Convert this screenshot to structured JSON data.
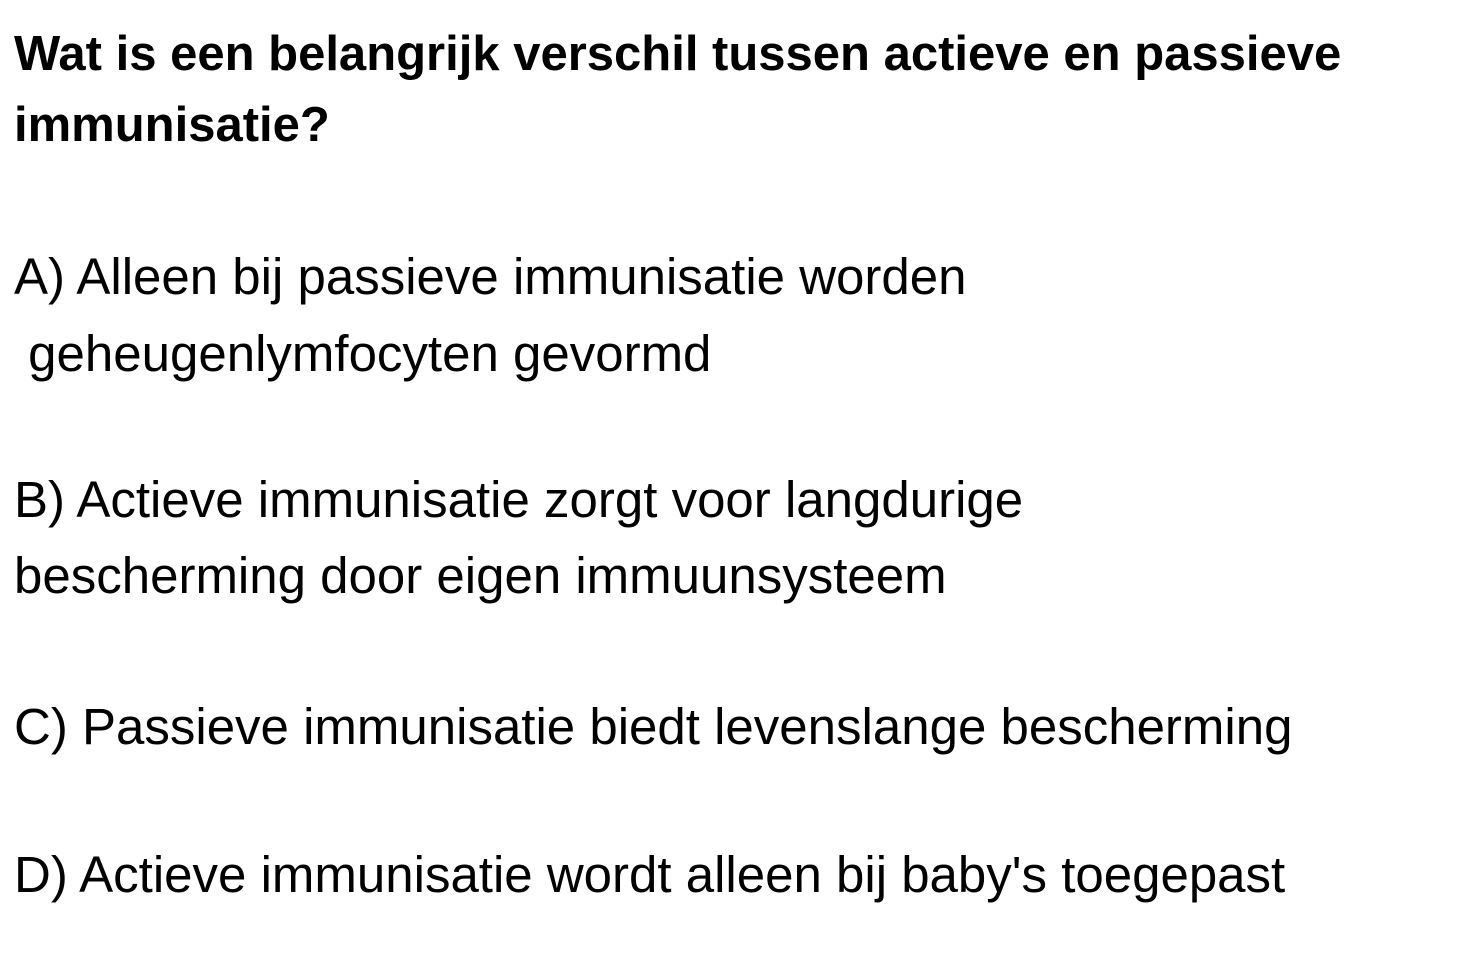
{
  "question": {
    "line1": "Wat is een belangrijk verschil tussen actieve en passieve",
    "line2": "immunisatie?"
  },
  "options": {
    "a_line1": "A) Alleen bij passieve immunisatie worden",
    "a_line2": " geheugenlymfocyten gevormd",
    "b_line1": "B) Actieve immunisatie zorgt voor langdurige",
    "b_line2": "bescherming door eigen immuunsysteem",
    "c_line1": "C) Passieve immunisatie biedt levenslange bescherming",
    "d_line1": "D) Actieve immunisatie wordt alleen bij baby's toegepast"
  }
}
